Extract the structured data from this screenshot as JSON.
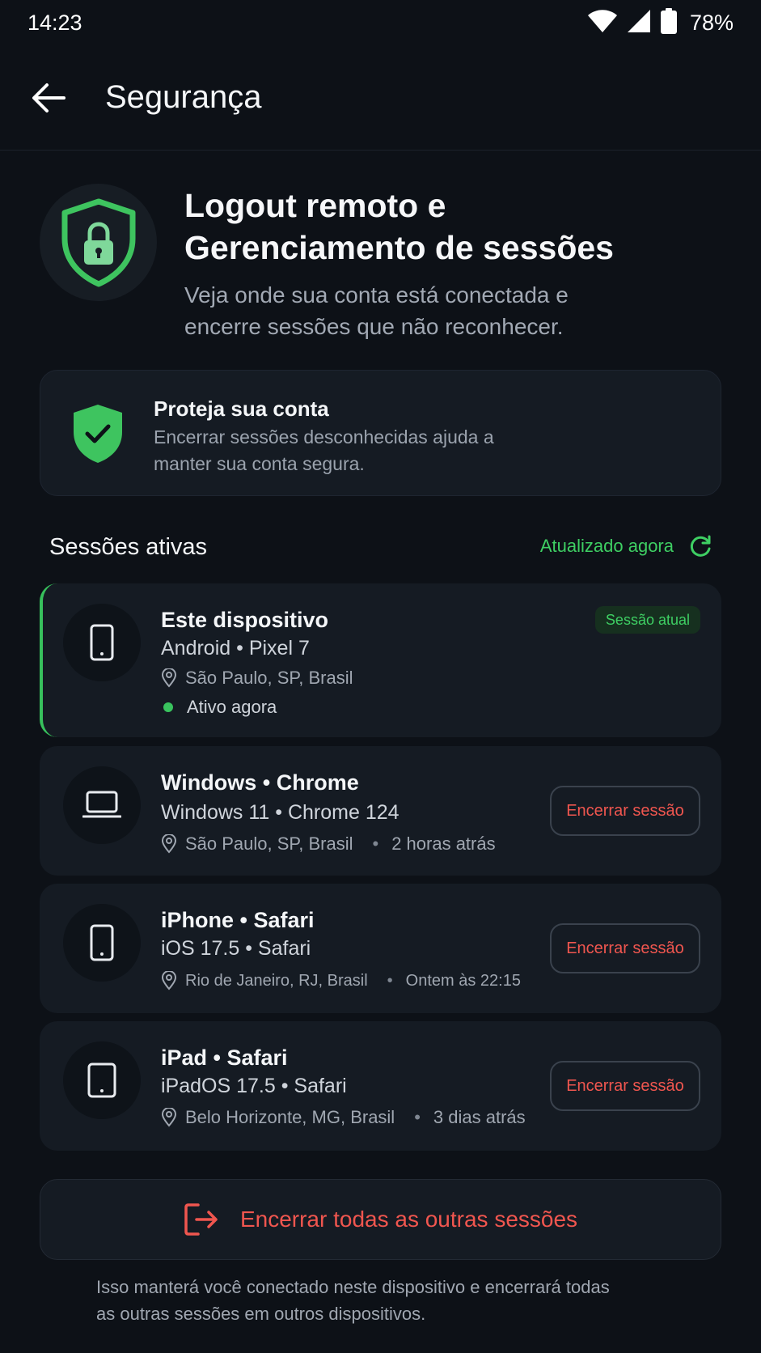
{
  "status_bar": {
    "time": "14:23",
    "battery": "78%"
  },
  "header": {
    "title": "Segurança"
  },
  "hero": {
    "title_line1": "Logout remoto e",
    "title_line2": "Gerenciamento de sessões",
    "subtitle_line1": "Veja onde sua conta está conectada e",
    "subtitle_line2": "encerre sessões que não reconhecer."
  },
  "protect": {
    "title": "Proteja sua conta",
    "desc_line1": "Encerrar sessões desconhecidas ajuda a",
    "desc_line2": "manter sua conta segura."
  },
  "sessions_header": {
    "title": "Sessões ativas",
    "updated": "Atualizado agora"
  },
  "sessions": [
    {
      "name": "Este dispositivo",
      "detail": "Android • Pixel 7",
      "location": "São Paulo, SP, Brasil",
      "status": "Ativo agora",
      "badge": "Sessão atual",
      "icon": "phone-icon"
    },
    {
      "name": "Windows • Chrome",
      "detail": "Windows 11 • Chrome 124",
      "location": "São Paulo, SP, Brasil",
      "time": "2 horas atrás",
      "action": "Encerrar sessão",
      "icon": "laptop-icon"
    },
    {
      "name": "iPhone • Safari",
      "detail": "iOS 17.5 • Safari",
      "location": "Rio de Janeiro, RJ, Brasil",
      "time": "Ontem às 22:15",
      "action": "Encerrar sessão",
      "icon": "phone-icon"
    },
    {
      "name": "iPad • Safari",
      "detail": "iPadOS 17.5 • Safari",
      "location": "Belo Horizonte, MG, Brasil",
      "time": "3 dias atrás",
      "action": "Encerrar sessão",
      "icon": "tablet-icon"
    }
  ],
  "end_all": {
    "label": "Encerrar todas as outras sessões"
  },
  "footer": {
    "line1": "Isso manterá você conectado neste dispositivo e encerrará todas",
    "line2": "as outras sessões em outros dispositivos."
  },
  "colors": {
    "background": "#0d1117",
    "card": "#151b23",
    "accent_green": "#3ecf63",
    "danger_red": "#f0564f"
  }
}
